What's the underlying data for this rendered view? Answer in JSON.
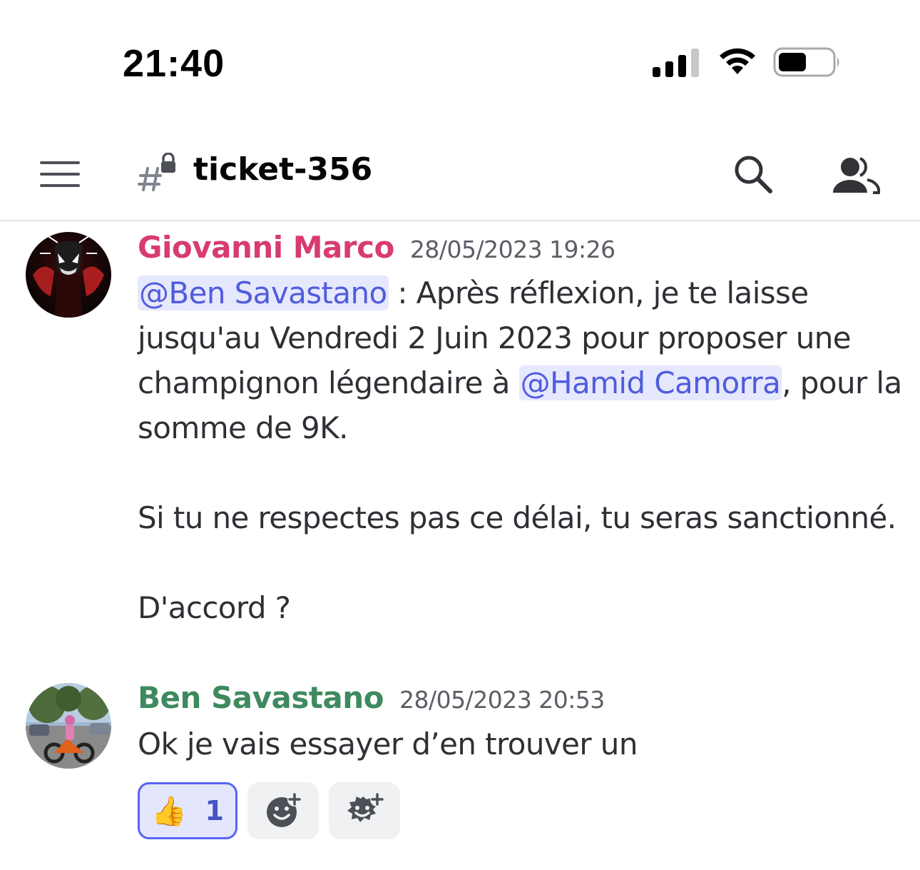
{
  "status_bar": {
    "time": "21:40",
    "signal_icon": "cellular-signal-icon",
    "wifi_icon": "wifi-icon",
    "battery_icon": "battery-icon"
  },
  "header": {
    "channel_name": "ticket-356",
    "channel_icon": "locked-text-channel-icon",
    "menu_icon": "hamburger-menu-icon",
    "search_icon": "search-icon",
    "members_icon": "members-icon"
  },
  "messages": [
    {
      "author": "Giovanni Marco",
      "author_color": "#d83c6e",
      "timestamp": "28/05/2023 19:26",
      "mention_1": "@Ben Savastano",
      "text_1": " : Après réflexion, je te laisse jusqu'au Vendredi 2 Juin 2023 pour proposer une champignon légendaire à ",
      "mention_2": "@Hamid Camorra",
      "text_2": ", pour la somme de 9K.",
      "paragraph_2": "Si tu ne respectes pas ce délai, tu seras sanctionné.",
      "paragraph_3": "D'accord ?"
    },
    {
      "author": "Ben Savastano",
      "author_color": "#3e8a5e",
      "timestamp": "28/05/2023 20:53",
      "text": "Ok je vais essayer d’en trouver un"
    }
  ],
  "reactions": [
    {
      "emoji": "👍",
      "count": "1",
      "active": true
    },
    {
      "icon": "add-reaction-icon"
    },
    {
      "icon": "add-super-reaction-icon"
    }
  ],
  "colors": {
    "mention_bg": "#e6e8fd",
    "mention_text": "#505cdc",
    "active_reaction_border": "#5865f2"
  }
}
